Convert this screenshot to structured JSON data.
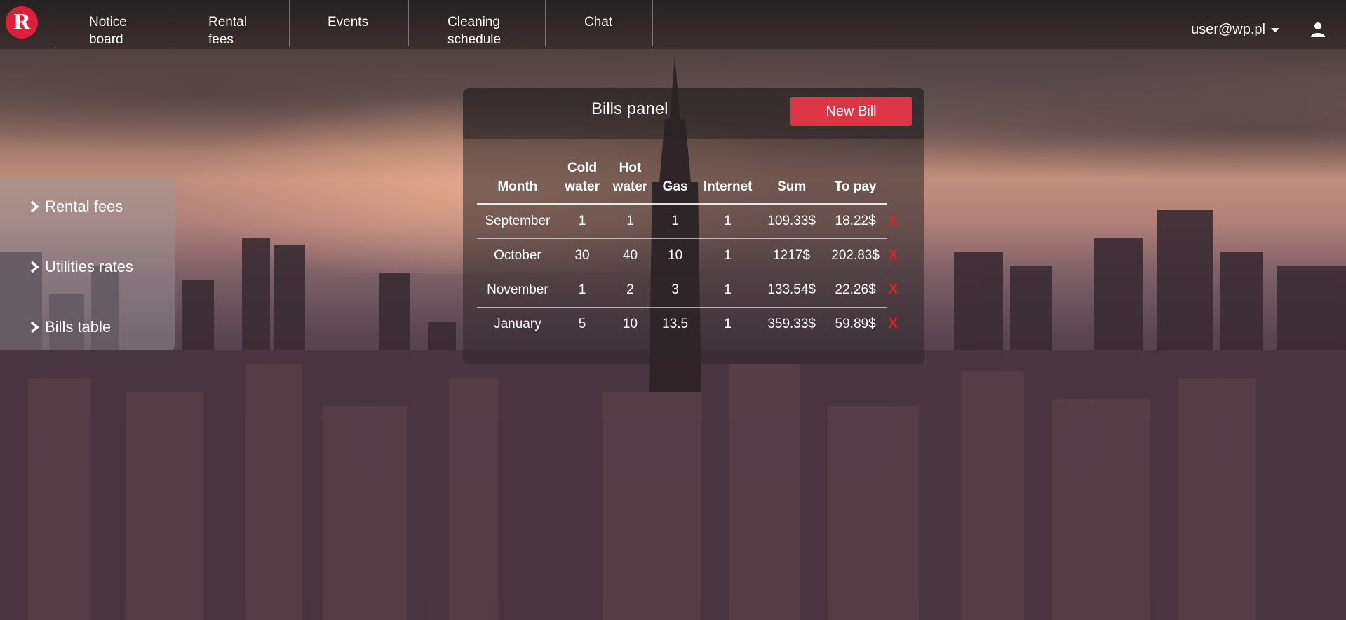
{
  "brand": {
    "logo_letter": "R",
    "accent": "#e01e37"
  },
  "nav": {
    "items": [
      {
        "label_line1": "Notice",
        "label_line2": "board"
      },
      {
        "label_line1": "Rental",
        "label_line2": "fees"
      },
      {
        "label_line1": "Events",
        "label_line2": ""
      },
      {
        "label_line1": "Cleaning",
        "label_line2": "schedule"
      },
      {
        "label_line1": "Chat",
        "label_line2": ""
      }
    ],
    "user_email": "user@wp.pl",
    "user_icon": "user-icon"
  },
  "sidebar": {
    "items": [
      {
        "label": "Rental fees",
        "icon": "chevron-right-icon"
      },
      {
        "label": "Utilities rates",
        "icon": "chevron-right-icon"
      },
      {
        "label": "Bills table",
        "icon": "chevron-right-icon"
      }
    ]
  },
  "bills_panel": {
    "title": "Bills panel",
    "new_bill_label": "New Bill",
    "button_color": "#dc3545",
    "columns": [
      {
        "line1": "",
        "line2": "Month"
      },
      {
        "line1": "Cold",
        "line2": "water"
      },
      {
        "line1": "Hot",
        "line2": "water"
      },
      {
        "line1": "",
        "line2": "Gas"
      },
      {
        "line1": "",
        "line2": "Internet"
      },
      {
        "line1": "",
        "line2": "Sum"
      },
      {
        "line1": "",
        "line2": "To pay"
      }
    ],
    "rows": [
      {
        "month": "September",
        "cold": "1",
        "hot": "1",
        "gas": "1",
        "internet": "1",
        "sum": "109.33$",
        "to_pay": "18.22$",
        "delete": "X"
      },
      {
        "month": "October",
        "cold": "30",
        "hot": "40",
        "gas": "10",
        "internet": "1",
        "sum": "1217$",
        "to_pay": "202.83$",
        "delete": "X"
      },
      {
        "month": "November",
        "cold": "1",
        "hot": "2",
        "gas": "3",
        "internet": "1",
        "sum": "133.54$",
        "to_pay": "22.26$",
        "delete": "X"
      },
      {
        "month": "January",
        "cold": "5",
        "hot": "10",
        "gas": "13.5",
        "internet": "1",
        "sum": "359.33$",
        "to_pay": "59.89$",
        "delete": "X"
      }
    ]
  }
}
